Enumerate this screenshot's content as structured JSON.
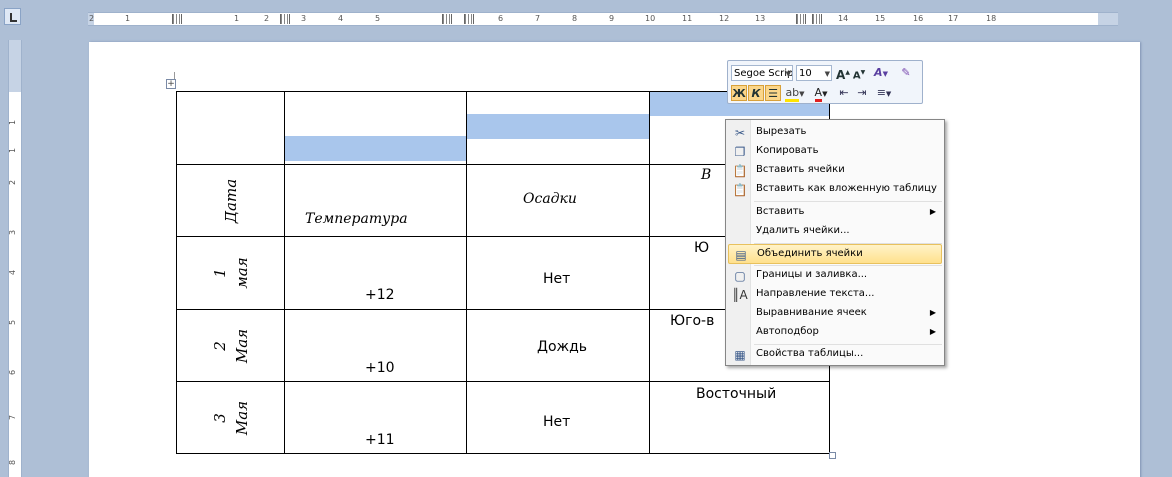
{
  "ruler": {
    "h_numbers": [
      "2",
      "1",
      "1",
      "2",
      "3",
      "4",
      "5",
      "6",
      "7",
      "8",
      "9",
      "10",
      "11",
      "12",
      "13",
      "14",
      "15",
      "16",
      "17",
      "18"
    ],
    "v_numbers": [
      "1",
      "1",
      "2",
      "3",
      "4",
      "5",
      "6",
      "7",
      "8"
    ]
  },
  "table": {
    "header": {
      "date": "Дата",
      "temperature": "Температура",
      "precipitation": "Осадки",
      "wind_partial": "В"
    },
    "rows": [
      {
        "day_num": "1",
        "day_label": "мая",
        "temp": "+12",
        "precip": "Нет",
        "wind": "Ю"
      },
      {
        "day_num": "2",
        "day_label": "Мая",
        "temp": "+10",
        "precip": "Дождь",
        "wind": "Юго-в"
      },
      {
        "day_num": "3",
        "day_label": "Мая",
        "temp": "+11",
        "precip": "Нет",
        "wind": "Восточный"
      }
    ]
  },
  "mini_toolbar": {
    "font_name": "Segoe Scrip",
    "font_size": "10",
    "grow_font": "A",
    "shrink_font": "A",
    "bold": "Ж",
    "italic": "К",
    "text_color_letter": "A"
  },
  "context_menu": {
    "items": [
      {
        "label": "Вырезать",
        "icon": "scissors-icon"
      },
      {
        "label": "Копировать",
        "icon": "copy-icon"
      },
      {
        "label": "Вставить ячейки",
        "icon": "paste-icon"
      },
      {
        "label": "Вставить как вложенную таблицу",
        "icon": "paste-icon"
      },
      {
        "label": "Вставить",
        "icon": "",
        "submenu": true
      },
      {
        "label": "Удалить ячейки...",
        "icon": ""
      },
      {
        "label": "Объединить ячейки",
        "icon": "merge-cells-icon",
        "highlighted": true
      },
      {
        "label": "Границы и заливка...",
        "icon": "borders-icon"
      },
      {
        "label": "Направление текста...",
        "icon": "text-direction-icon"
      },
      {
        "label": "Выравнивание ячеек",
        "icon": "",
        "submenu": true
      },
      {
        "label": "Автоподбор",
        "icon": "",
        "submenu": true
      },
      {
        "label": "Свойства таблицы...",
        "icon": "table-properties-icon"
      }
    ]
  },
  "colors": {
    "selection": "#a9c6ec",
    "highlight": "#ffe18d",
    "workspace": "#aebfd6"
  }
}
